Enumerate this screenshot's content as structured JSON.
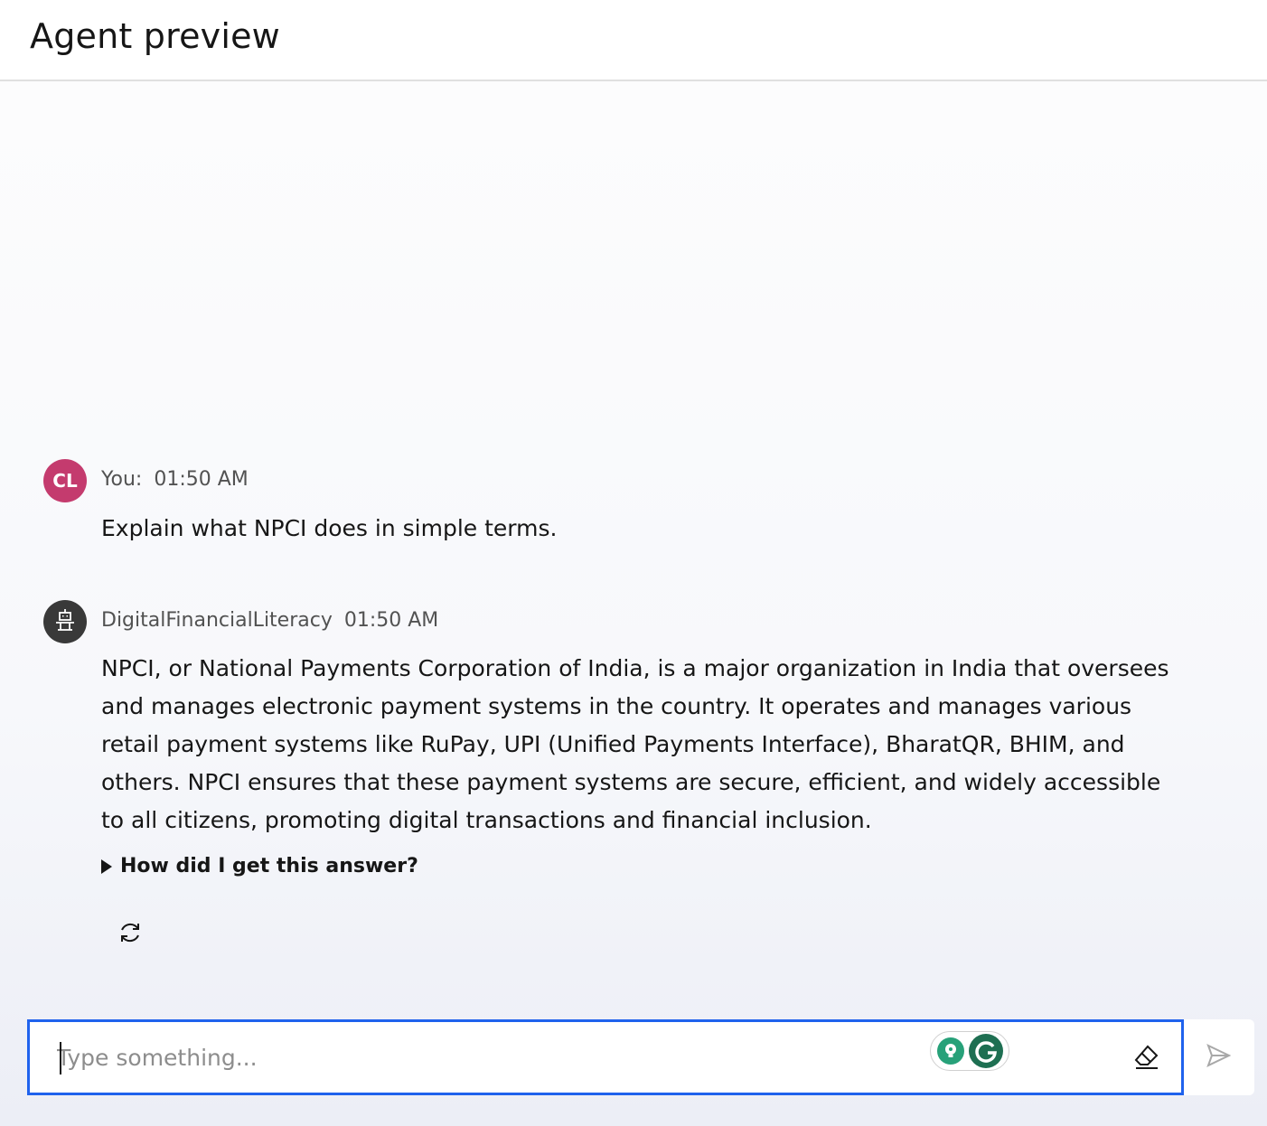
{
  "header": {
    "title": "Agent preview"
  },
  "messages": [
    {
      "role": "user",
      "avatar_initials": "CL",
      "sender": "You:",
      "time": "01:50 AM",
      "text": "Explain what NPCI does in simple terms."
    },
    {
      "role": "agent",
      "avatar_icon": "robot-icon",
      "sender": "DigitalFinancialLiteracy",
      "time": "01:50 AM",
      "text": "NPCI, or National Payments Corporation of India, is a major organization in India that oversees and manages electronic payment systems in the country. It operates and manages various retail payment systems like RuPay, UPI (Unified Payments Interface), BharatQR, BHIM, and others. NPCI ensures that these payment systems are secure, efficient, and widely accessible to all citizens, promoting digital transactions and financial inclusion.",
      "explain_label": "How did I get this answer?",
      "actions": [
        "regenerate-icon"
      ]
    }
  ],
  "composer": {
    "placeholder": "Type something...",
    "value": "",
    "icons": [
      "grammarly-suggestion-icon",
      "grammarly-logo-icon",
      "eraser-icon",
      "send-icon"
    ]
  },
  "colors": {
    "user_avatar": "#c43b6e",
    "agent_avatar": "#393939",
    "input_focus_border": "#1f62ed",
    "grammarly_green": "#27a179"
  }
}
